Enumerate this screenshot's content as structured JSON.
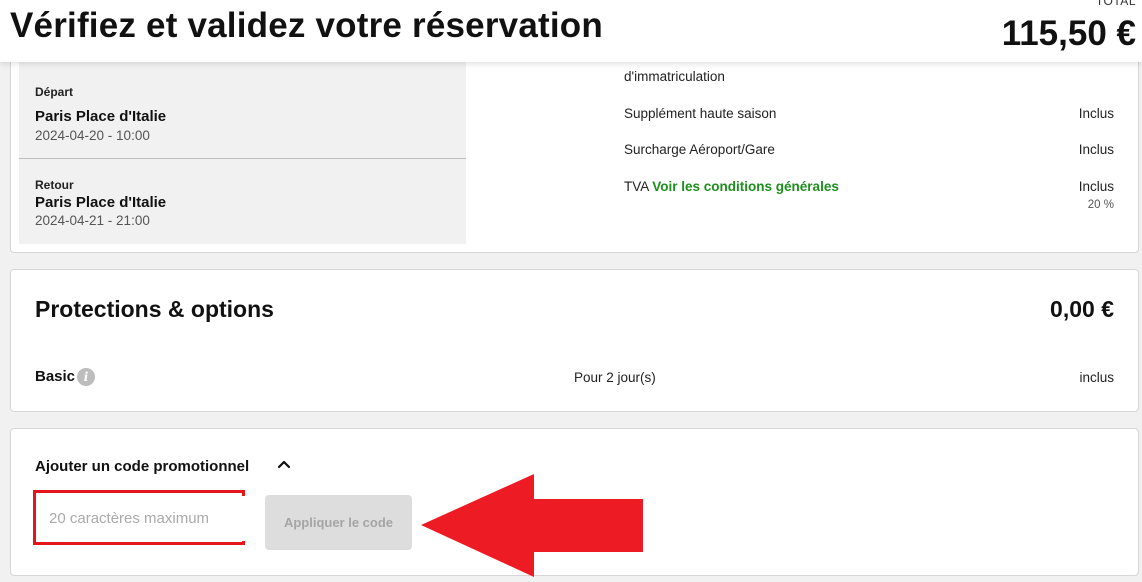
{
  "header": {
    "title": "Vérifiez et validez votre réservation",
    "total_label": "TOTAL",
    "total_amount": "115,50 €"
  },
  "trip": {
    "departure": {
      "label": "Départ",
      "place": "Paris Place d'Italie",
      "datetime": "2024-04-20 - 10:00"
    },
    "return": {
      "label": "Retour",
      "place": "Paris Place d'Italie",
      "datetime": "2024-04-21 - 21:00"
    }
  },
  "fees": {
    "registration_tail": "d'immatriculation",
    "items": [
      {
        "label": "Supplément haute saison",
        "value": "Inclus"
      },
      {
        "label": "Surcharge Aéroport/Gare",
        "value": "Inclus"
      }
    ],
    "vat": {
      "label": "TVA",
      "link": "Voir les conditions générales",
      "value": "Inclus",
      "rate": "20 %"
    }
  },
  "protections": {
    "title": "Protections & options",
    "amount": "0,00 €",
    "basic": {
      "label": "Basic",
      "info_icon": "info-icon",
      "duration": "Pour 2 jour(s)",
      "status": "inclus"
    }
  },
  "promo": {
    "title": "Ajouter un code promotionnel",
    "chevron_icon": "chevron-up-icon",
    "placeholder": "20 caractères maximum",
    "apply_label": "Appliquer le code"
  },
  "annotations": {
    "arrow_color": "#e3161b",
    "highlight_color": "#e3161b"
  },
  "colors": {
    "link_green": "#1d8f1d",
    "button_disabled_bg": "#dddddd"
  }
}
